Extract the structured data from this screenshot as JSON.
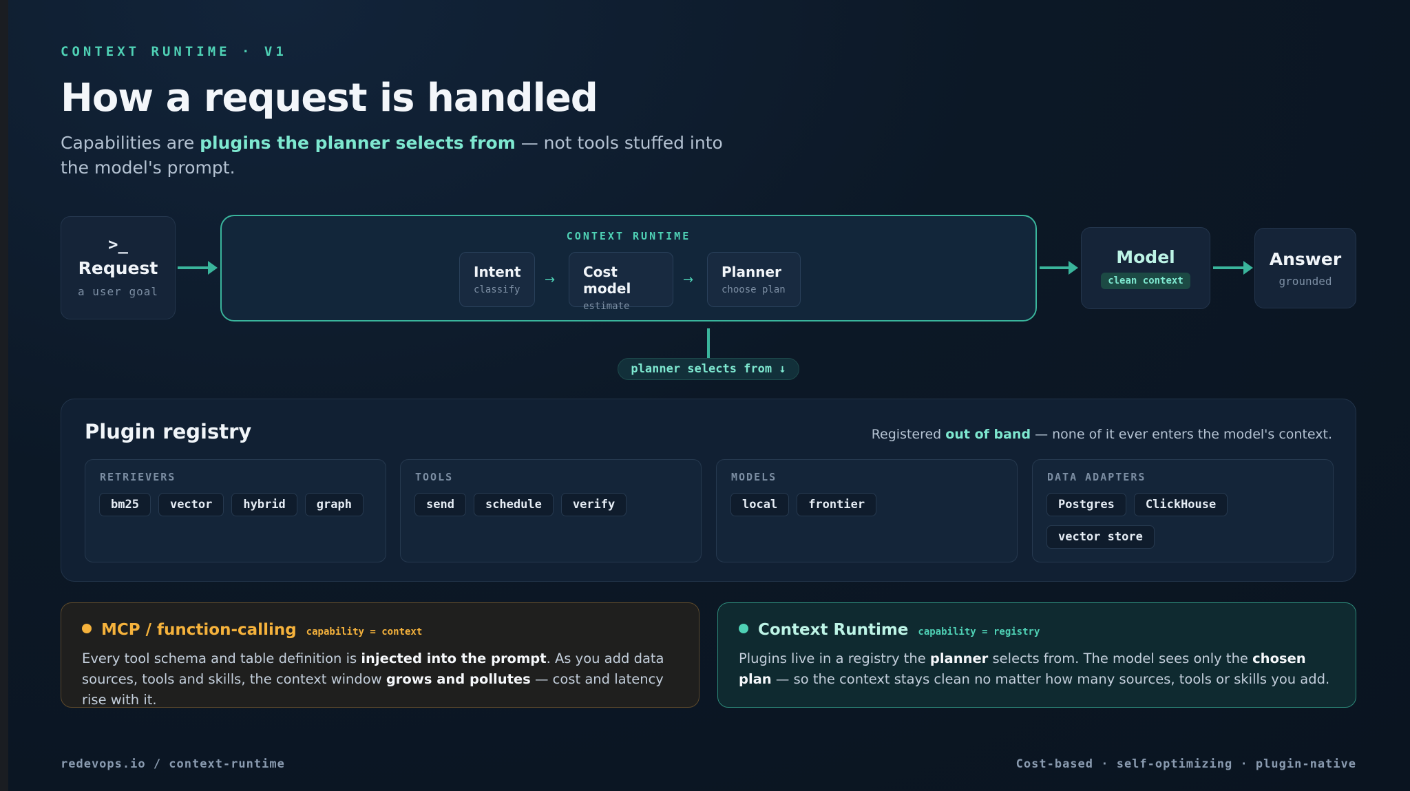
{
  "header": {
    "eyebrow": "CONTEXT RUNTIME · V1",
    "title": "How a request is handled",
    "subtitle_pre": "Capabilities are ",
    "subtitle_bold": "plugins the planner selects from",
    "subtitle_post": " — not tools stuffed into the model's prompt."
  },
  "flow": {
    "request": {
      "glyph": ">_",
      "title": "Request",
      "subtitle": "a user goal"
    },
    "runtime": {
      "label": "CONTEXT RUNTIME",
      "steps": [
        {
          "title": "Intent",
          "subtitle": "classify"
        },
        {
          "title": "Cost model",
          "subtitle": "estimate"
        },
        {
          "title": "Planner",
          "subtitle": "choose plan"
        }
      ],
      "step_arrow": "→"
    },
    "model": {
      "title": "Model",
      "pill": "clean context"
    },
    "answer": {
      "title": "Answer",
      "subtitle": "grounded"
    },
    "selects_label": "planner selects from ↓"
  },
  "registry": {
    "title": "Plugin registry",
    "note_pre": "Registered ",
    "note_bold": "out of band",
    "note_post": " — none of it ever enters the model's context.",
    "groups": [
      {
        "label": "RETRIEVERS",
        "items": [
          "bm25",
          "vector",
          "hybrid",
          "graph"
        ]
      },
      {
        "label": "TOOLS",
        "items": [
          "send",
          "schedule",
          "verify"
        ]
      },
      {
        "label": "MODELS",
        "items": [
          "local",
          "frontier"
        ]
      },
      {
        "label": "DATA ADAPTERS",
        "items": [
          "Postgres",
          "ClickHouse",
          "vector store"
        ]
      }
    ]
  },
  "cards": {
    "mcp": {
      "title": "MCP / function-calling",
      "tag": "capability = context",
      "t1": "Every tool schema and table definition is ",
      "b1": "injected into the prompt",
      "t2": ". As you add data sources, tools and skills, the context window ",
      "b2": "grows and pollutes",
      "t3": " — cost and latency rise with it.",
      "accent": "#f5b23c"
    },
    "runtime": {
      "title": "Context Runtime",
      "tag": "capability = registry",
      "t1": "Plugins live in a registry the ",
      "b1": "planner",
      "t2": " selects from. The model sees only the ",
      "b2": "chosen plan",
      "t3": " — so the context stays clean no matter how many sources, tools or skills you add.",
      "accent": "#4fd1b5"
    }
  },
  "footer": {
    "left": "redevops.io / context-runtime",
    "right": "Cost-based · self-optimizing · plugin-native"
  }
}
